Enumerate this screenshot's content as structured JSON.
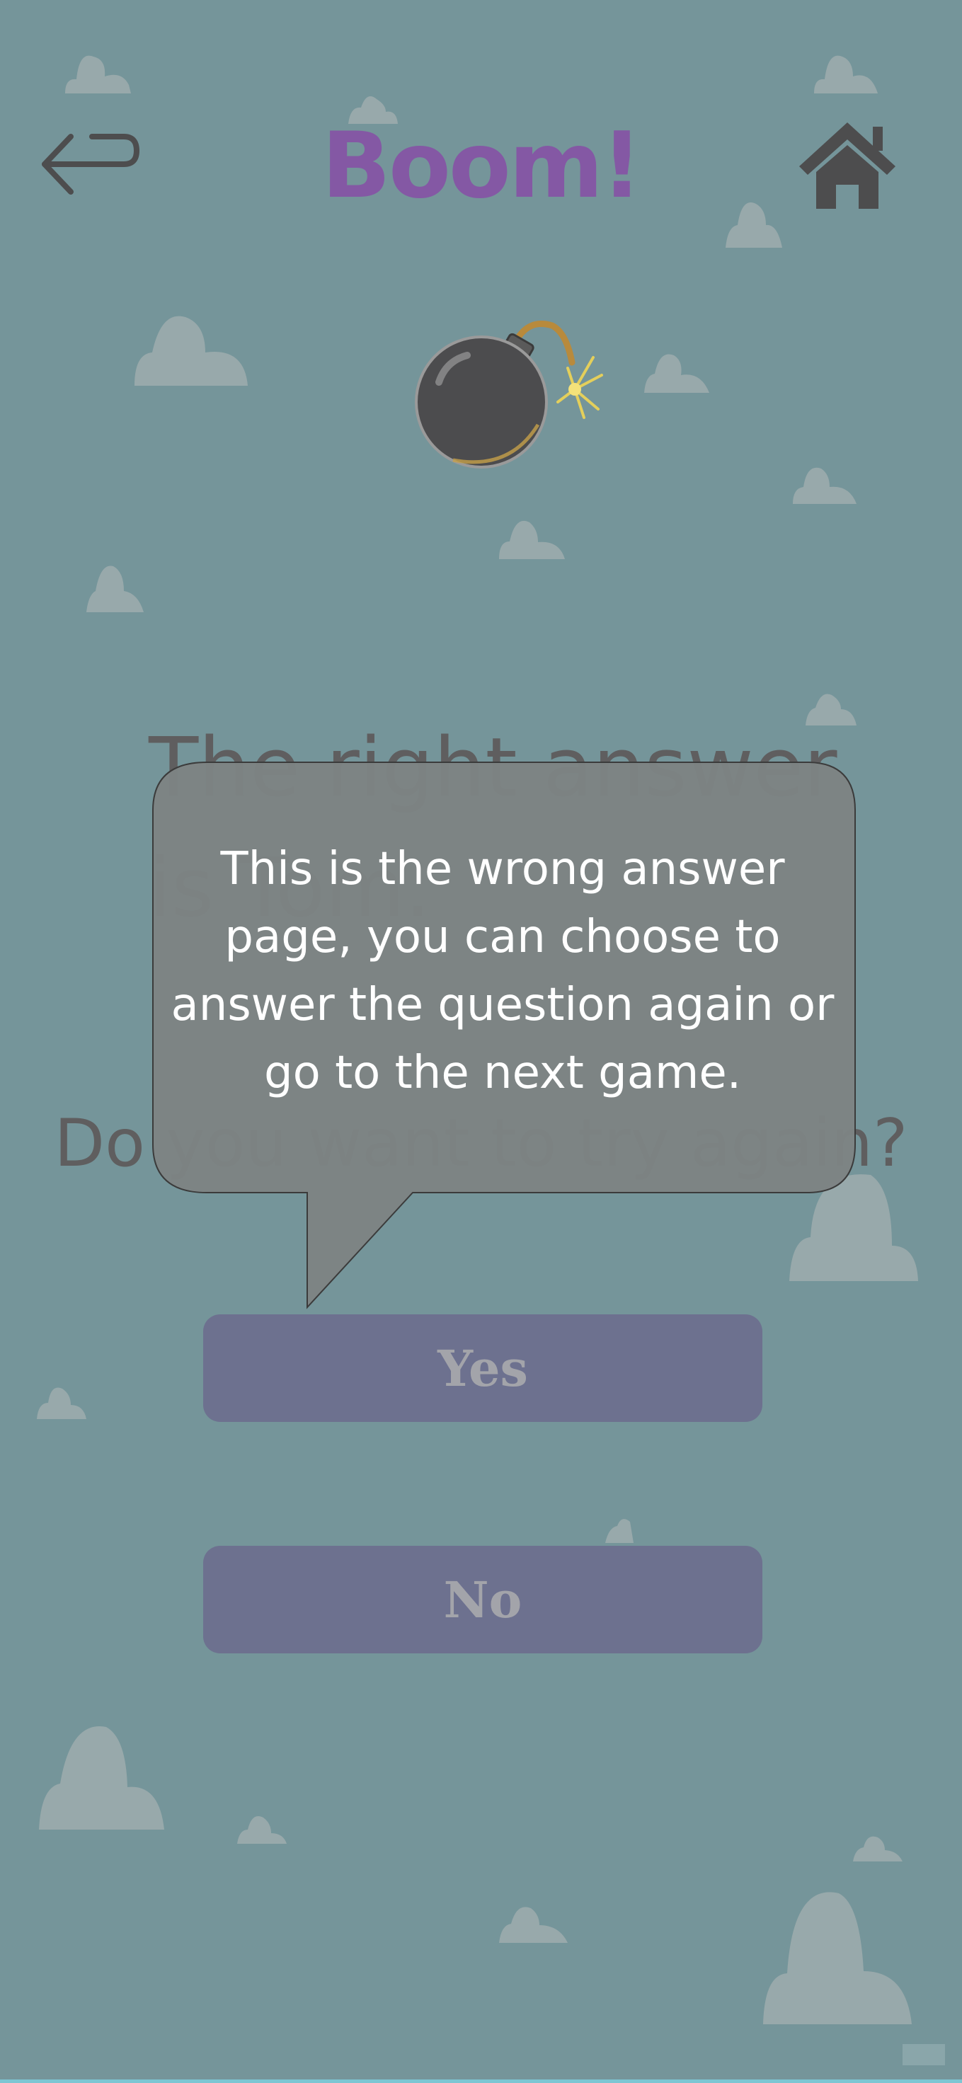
{
  "header": {
    "title": "Boom!",
    "back_icon": "back-arrow-icon",
    "home_icon": "home-icon"
  },
  "bomb_icon": "bomb-icon",
  "message": {
    "answer_text": "The right answer is Tom.",
    "try_again": "Do you want to try again?"
  },
  "tooltip": {
    "text": "This is the wrong answer page, you can choose to answer the question again or go to the next game."
  },
  "buttons": {
    "yes_label": "Yes",
    "no_label": "No"
  },
  "colors": {
    "background": "#75959a",
    "title": "#8458a4",
    "button": "#6d718f",
    "button_text": "#a3a4aa",
    "tooltip": "#7d8383"
  }
}
